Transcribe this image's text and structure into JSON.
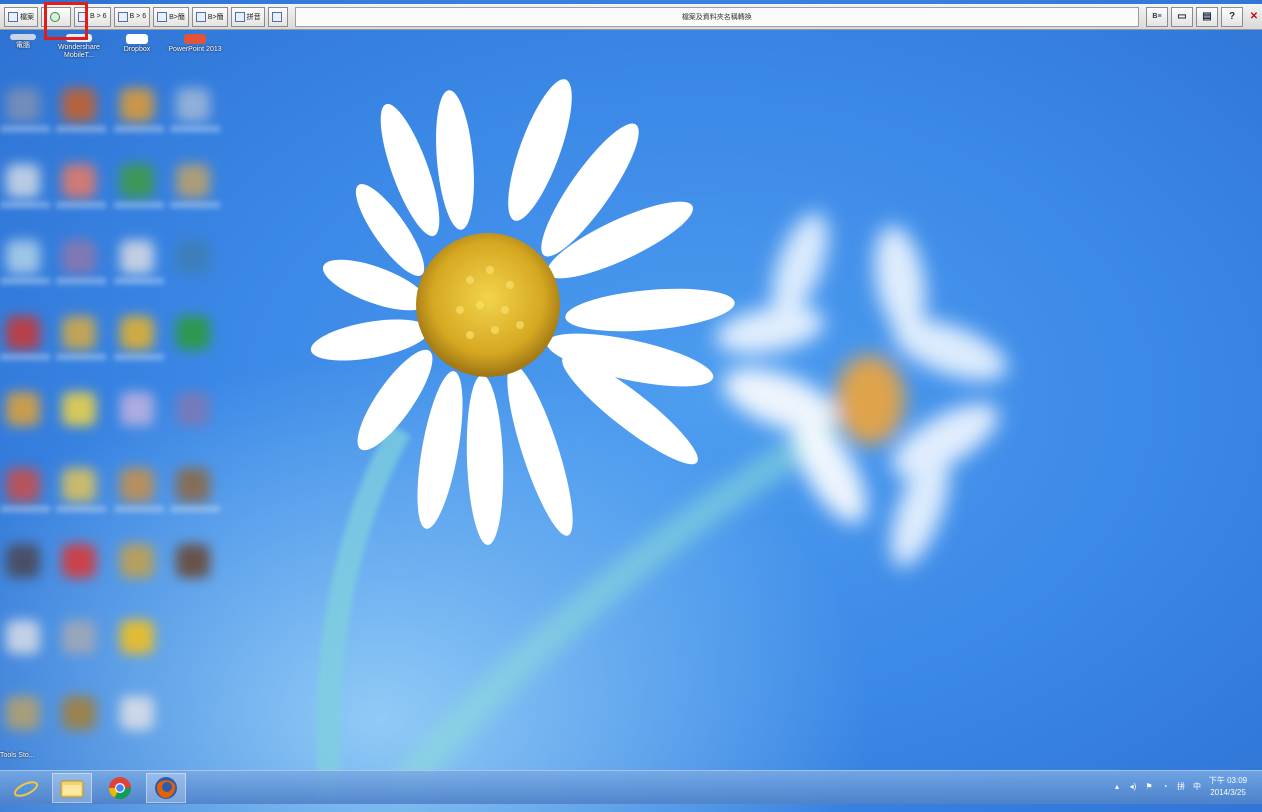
{
  "toolbar": {
    "title": "檔案及資料夾名稱轉換",
    "buttons": [
      {
        "label": "檔案"
      },
      {
        "label": ""
      },
      {
        "label": "B > 6"
      },
      {
        "label": "B > 6"
      },
      {
        "label": "B>簡"
      },
      {
        "label": "B>簡"
      },
      {
        "label": "拼音"
      },
      {
        "label": ""
      }
    ],
    "right_buttons": [
      {
        "label": "B≡"
      },
      {
        "label": "▭"
      },
      {
        "label": "▤"
      },
      {
        "label": "?"
      },
      {
        "label": "✕"
      }
    ]
  },
  "desktop_icons": [
    {
      "label": "電腦"
    },
    {
      "label": "Wondershare MobileT..."
    },
    {
      "label": "Dropbox"
    },
    {
      "label": "PowerPoint 2013"
    }
  ],
  "bottom_icon_label": "Tools Sto...",
  "taskbar": {
    "apps": [
      {
        "name": "Internet Explorer"
      },
      {
        "name": "File Explorer"
      },
      {
        "name": "Google Chrome"
      },
      {
        "name": "Firefox"
      }
    ],
    "clock_time": "下午 03:09",
    "clock_date": "2014/3/25"
  }
}
